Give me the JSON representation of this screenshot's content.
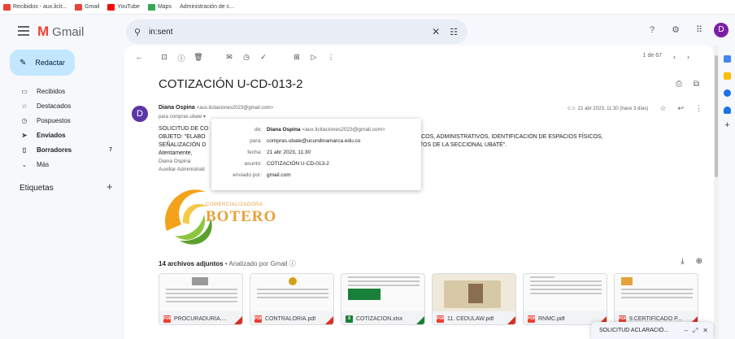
{
  "bookmarks": [
    {
      "label": "Recibidos - aux.licit...",
      "color": "#ea4335"
    },
    {
      "label": "Gmail",
      "color": "#ea4335"
    },
    {
      "label": "YouTube",
      "color": "#ff0000"
    },
    {
      "label": "Maps",
      "color": "#34a853"
    },
    {
      "label": "Administración de c...",
      "color": "#1a73e8"
    }
  ],
  "header": {
    "app_name": "Gmail",
    "search_value": "in:sent",
    "avatar_letter": "D",
    "icons": [
      "help-icon",
      "settings-icon",
      "apps-icon"
    ]
  },
  "sidebar": {
    "compose_label": "Redactar",
    "items": [
      {
        "label": "Recibidos",
        "icon": "inbox-icon",
        "glyph": "▭",
        "count": "",
        "bold": false
      },
      {
        "label": "Destacados",
        "icon": "star-icon",
        "glyph": "☆",
        "count": "",
        "bold": false
      },
      {
        "label": "Pospuestos",
        "icon": "clock-icon",
        "glyph": "◷",
        "count": "",
        "bold": false
      },
      {
        "label": "Enviados",
        "icon": "send-icon",
        "glyph": "➤",
        "count": "",
        "bold": true
      },
      {
        "label": "Borradores",
        "icon": "draft-icon",
        "glyph": "▯",
        "count": "7",
        "bold": true
      },
      {
        "label": "Más",
        "icon": "chevron-down-icon",
        "glyph": "⌄",
        "count": "",
        "bold": false
      }
    ],
    "labels_heading": "Etiquetas"
  },
  "toolbar": {
    "pager_text": "1 de 67"
  },
  "email": {
    "subject": "COTIZACIÓN U-CD-013-2",
    "sender_name": "Diana Ospina",
    "sender_email": "<aux.licitaciones2023@gmail.com>",
    "to_line": "para compras.ubate ▾",
    "avatar_letter": "D",
    "date_text": "21 abr 2023, 11:30 (hace 3 días)",
    "body_lines": [
      "SOLICITUD DE CO",
      "OBJETO: \"ELABO                                                                                                           ENTOS ACADÉMICOS, ADMINISTRATIVOS, IDENTIFICACIÓN DE ESPACIOS FÍSICOS,",
      "SEÑALIZACIÓN D                                                                                                           ACIÓN EN EVENTOS DE LA SECCIONAL UBATÉ\".",
      "Atentamente,"
    ],
    "signature_name": "Diana Ospina",
    "signature_role": "Auxiliar Administrati",
    "details": {
      "de_label": "de:",
      "de_name": "Diana Ospina",
      "de_email": "<aux.licitaciones2023@gmail.com>",
      "para_label": "para:",
      "para_value": "compras.ubate@ucundinamarca.edu.co",
      "fecha_label": "fecha:",
      "fecha_value": "21 abr 2023, 11:30",
      "asunto_label": "asunto:",
      "asunto_value": "COTIZACIÓN U-CD-013-2",
      "enviado_label": "enviado por:",
      "enviado_value": "gmail.com"
    }
  },
  "logo": {
    "small_text": "COMERCIALIZADORA",
    "big_text": "BOTERO"
  },
  "attachments": {
    "count_label": "14 archivos adjuntos",
    "analyzed_label": "• Analizado por Gmail ⓘ",
    "files": [
      {
        "name": "PROCURADURIA....",
        "type": "pdf"
      },
      {
        "name": "CONTRALORIA.pdf",
        "type": "pdf"
      },
      {
        "name": "COTIZACION.xlsx",
        "type": "xlsx"
      },
      {
        "name": "11. CEDULAW.pdf",
        "type": "pdf"
      },
      {
        "name": "RNMC.pdf",
        "type": "pdf"
      },
      {
        "name": "9.CERTIFICADO P...",
        "type": "pdf"
      }
    ]
  },
  "minimized_compose": {
    "title": "SOLICITUD ACLARACIÓ..."
  }
}
